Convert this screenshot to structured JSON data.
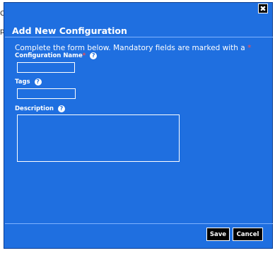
{
  "background": {
    "edge_glyphs": [
      "C",
      "p"
    ]
  },
  "dialog": {
    "title": "Add New Configuration",
    "close_icon": "close-icon",
    "close_symbol": "✖",
    "instructions": "Complete the form below. Mandatory fields are marked with a",
    "required_marker": "*",
    "fields": {
      "config_name": {
        "label": "Configuration Name",
        "value": "",
        "help_icon": "?"
      },
      "tags": {
        "label": "Tags",
        "value": "",
        "help_icon": "?"
      },
      "description": {
        "label": "Description",
        "value": "",
        "help_icon": "?"
      }
    },
    "buttons": {
      "save": "Save",
      "cancel": "Cancel"
    }
  },
  "colors": {
    "dialog_bg": "#1f6fe0",
    "required": "#ff4a4a",
    "button_bg": "#000000"
  }
}
